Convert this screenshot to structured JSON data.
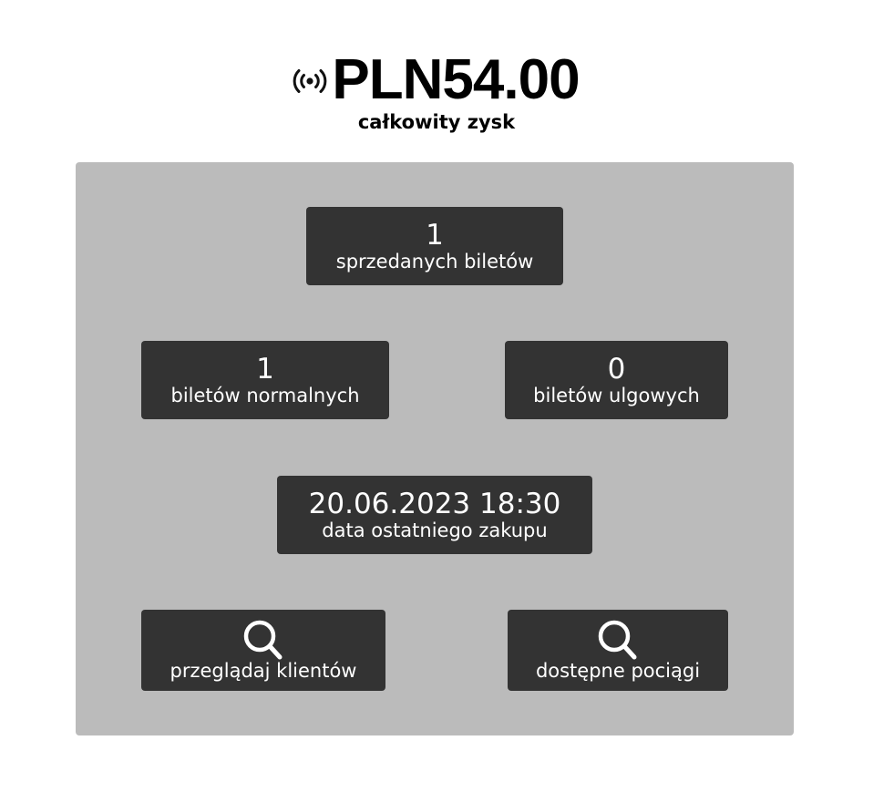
{
  "header": {
    "icon": "live-signal-icon",
    "total_profit": "PLN54.00",
    "total_profit_label": "całkowity zysk"
  },
  "stats": {
    "tickets_sold": {
      "value": "1",
      "label": "sprzedanych biletów"
    },
    "normal_tickets": {
      "value": "1",
      "label": "biletów normalnych"
    },
    "reduced_tickets": {
      "value": "0",
      "label": "biletów ulgowych"
    },
    "last_purchase": {
      "value": "20.06.2023 18:30",
      "label": "data ostatniego zakupu"
    }
  },
  "actions": {
    "browse_clients": {
      "icon": "search-icon",
      "label": "przeglądaj klientów"
    },
    "available_trains": {
      "icon": "search-icon",
      "label": "dostępne pociągi"
    }
  },
  "colors": {
    "panel_bg": "#bbbbbb",
    "tile_bg": "#333333",
    "tile_text": "#ffffff",
    "heading_text": "#000000"
  }
}
